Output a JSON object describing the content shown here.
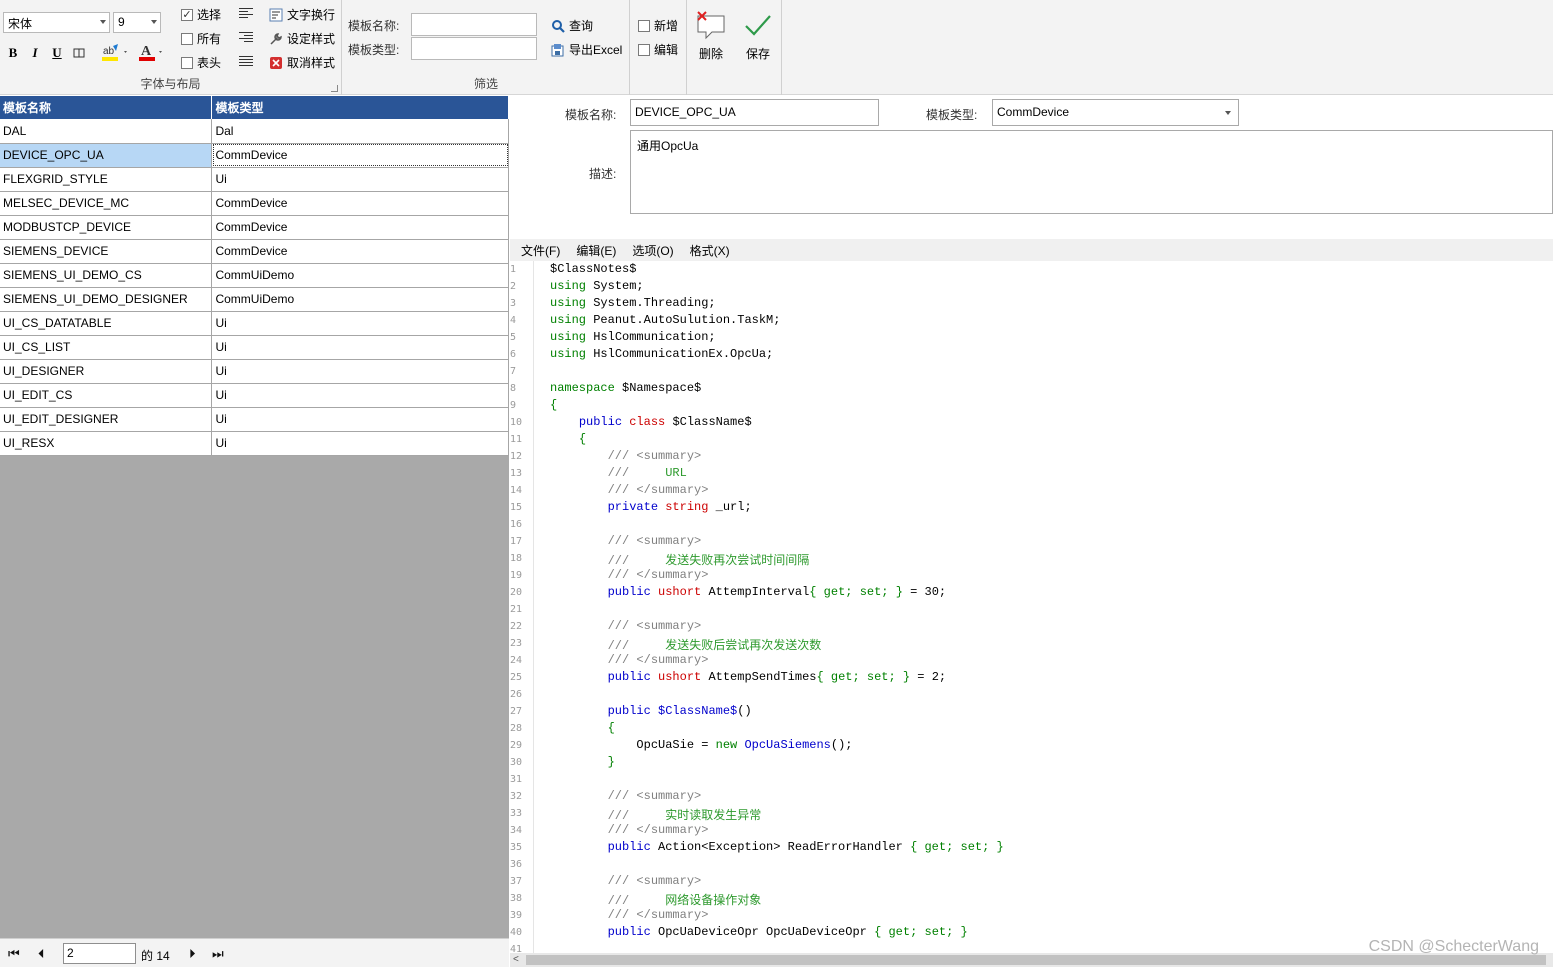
{
  "ribbon": {
    "font_group": {
      "font_name": "宋体",
      "font_size": "9",
      "bold": "B",
      "italic": "I",
      "underline": "U",
      "caption": "字体与布局"
    },
    "checks": [
      {
        "label": "选择",
        "checked": true
      },
      {
        "label": "所有",
        "checked": false
      },
      {
        "label": "表头",
        "checked": false
      }
    ],
    "style_buttons": [
      "文字换行",
      "设定样式",
      "取消样式"
    ],
    "filter_group": {
      "name_label": "模板名称:",
      "type_label": "模板类型:",
      "query": "查询",
      "export": "导出Excel",
      "caption": "筛选"
    },
    "edit_checks": [
      {
        "label": "新增",
        "checked": false
      },
      {
        "label": "编辑",
        "checked": false
      }
    ],
    "delete_label": "删除",
    "save_label": "保存"
  },
  "grid": {
    "headers": [
      "模板名称",
      "模板类型"
    ],
    "rows": [
      {
        "name": "DAL",
        "type": "Dal"
      },
      {
        "name": "DEVICE_OPC_UA",
        "type": "CommDevice"
      },
      {
        "name": "FLEXGRID_STYLE",
        "type": "Ui"
      },
      {
        "name": "MELSEC_DEVICE_MC",
        "type": "CommDevice"
      },
      {
        "name": "MODBUSTCP_DEVICE",
        "type": "CommDevice"
      },
      {
        "name": "SIEMENS_DEVICE",
        "type": "CommDevice"
      },
      {
        "name": "SIEMENS_UI_DEMO_CS",
        "type": "CommUiDemo"
      },
      {
        "name": "SIEMENS_UI_DEMO_DESIGNER",
        "type": "CommUiDemo"
      },
      {
        "name": "UI_CS_DATATABLE",
        "type": "Ui"
      },
      {
        "name": "UI_CS_LIST",
        "type": "Ui"
      },
      {
        "name": "UI_DESIGNER",
        "type": "Ui"
      },
      {
        "name": "UI_EDIT_CS",
        "type": "Ui"
      },
      {
        "name": "UI_EDIT_DESIGNER",
        "type": "Ui"
      },
      {
        "name": "UI_RESX",
        "type": "Ui"
      }
    ],
    "selected_row": 1
  },
  "pager": {
    "current": "2",
    "total": "的 14"
  },
  "detail": {
    "name_label": "模板名称:",
    "name_value": "DEVICE_OPC_UA",
    "type_label": "模板类型:",
    "type_value": "CommDevice",
    "desc_label": "描述:",
    "desc_value": "通用OpcUa"
  },
  "editor_menu": [
    "文件(F)",
    "编辑(E)",
    "选项(O)",
    "格式(X)"
  ],
  "code_lines": [
    [
      [
        "",
        "$ClassNotes$"
      ]
    ],
    [
      [
        "kg",
        "using"
      ],
      [
        "",
        " System;"
      ]
    ],
    [
      [
        "kg",
        "using"
      ],
      [
        "",
        " System.Threading;"
      ]
    ],
    [
      [
        "kg",
        "using"
      ],
      [
        "",
        " Peanut.AutoSulution.TaskM;"
      ]
    ],
    [
      [
        "kg",
        "using"
      ],
      [
        "",
        " HslCommunication;"
      ]
    ],
    [
      [
        "kg",
        "using"
      ],
      [
        "",
        " HslCommunicationEx.OpcUa;"
      ]
    ],
    [],
    [
      [
        "kg",
        "namespace"
      ],
      [
        "",
        " $Namespace$"
      ]
    ],
    [
      [
        "kg",
        "{"
      ]
    ],
    [
      [
        "",
        "    "
      ],
      [
        "kw",
        "public"
      ],
      [
        "",
        " "
      ],
      [
        "tp",
        "class"
      ],
      [
        "",
        " $ClassName$"
      ]
    ],
    [
      [
        "",
        "    "
      ],
      [
        "kg",
        "{"
      ]
    ],
    [
      [
        "",
        "        "
      ],
      [
        "cm",
        "/// <summary>"
      ]
    ],
    [
      [
        "",
        "        "
      ],
      [
        "cm",
        "///     "
      ],
      [
        "cz",
        "URL"
      ]
    ],
    [
      [
        "",
        "        "
      ],
      [
        "cm",
        "/// </summary>"
      ]
    ],
    [
      [
        "",
        "        "
      ],
      [
        "kw",
        "private"
      ],
      [
        "",
        " "
      ],
      [
        "tp",
        "string"
      ],
      [
        "",
        " _url;"
      ]
    ],
    [],
    [
      [
        "",
        "        "
      ],
      [
        "cm",
        "/// <summary>"
      ]
    ],
    [
      [
        "",
        "        "
      ],
      [
        "cm",
        "///     "
      ],
      [
        "cz",
        "发送失败再次尝试时间间隔"
      ]
    ],
    [
      [
        "",
        "        "
      ],
      [
        "cm",
        "/// </summary>"
      ]
    ],
    [
      [
        "",
        "        "
      ],
      [
        "kw",
        "public"
      ],
      [
        "",
        " "
      ],
      [
        "tp",
        "ushort"
      ],
      [
        "",
        " AttempInterval"
      ],
      [
        "kg",
        "{ get; set; }"
      ],
      [
        "",
        " = 30;"
      ]
    ],
    [],
    [
      [
        "",
        "        "
      ],
      [
        "cm",
        "/// <summary>"
      ]
    ],
    [
      [
        "",
        "        "
      ],
      [
        "cm",
        "///     "
      ],
      [
        "cz",
        "发送失败后尝试再次发送次数"
      ]
    ],
    [
      [
        "",
        "        "
      ],
      [
        "cm",
        "/// </summary>"
      ]
    ],
    [
      [
        "",
        "        "
      ],
      [
        "kw",
        "public"
      ],
      [
        "",
        " "
      ],
      [
        "tp",
        "ushort"
      ],
      [
        "",
        " AttempSendTimes"
      ],
      [
        "kg",
        "{ get; set; }"
      ],
      [
        "",
        " = 2;"
      ]
    ],
    [],
    [
      [
        "",
        "        "
      ],
      [
        "kw",
        "public"
      ],
      [
        "",
        " "
      ],
      [
        "kw",
        "$ClassName$"
      ],
      [
        "",
        "()"
      ]
    ],
    [
      [
        "",
        "        "
      ],
      [
        "kg",
        "{"
      ]
    ],
    [
      [
        "",
        "            OpcUaSie = "
      ],
      [
        "kg",
        "new"
      ],
      [
        "",
        " "
      ],
      [
        "kw",
        "OpcUaSiemens"
      ],
      [
        "",
        "();"
      ]
    ],
    [
      [
        "",
        "        "
      ],
      [
        "kg",
        "}"
      ]
    ],
    [],
    [
      [
        "",
        "        "
      ],
      [
        "cm",
        "/// <summary>"
      ]
    ],
    [
      [
        "",
        "        "
      ],
      [
        "cm",
        "///     "
      ],
      [
        "cz",
        "实时读取发生异常"
      ]
    ],
    [
      [
        "",
        "        "
      ],
      [
        "cm",
        "/// </summary>"
      ]
    ],
    [
      [
        "",
        "        "
      ],
      [
        "kw",
        "public"
      ],
      [
        "",
        " Action<Exception> ReadErrorHandler "
      ],
      [
        "kg",
        "{ get; set; }"
      ]
    ],
    [],
    [
      [
        "",
        "        "
      ],
      [
        "cm",
        "/// <summary>"
      ]
    ],
    [
      [
        "",
        "        "
      ],
      [
        "cm",
        "///     "
      ],
      [
        "cz",
        "网络设备操作对象"
      ]
    ],
    [
      [
        "",
        "        "
      ],
      [
        "cm",
        "/// </summary>"
      ]
    ],
    [
      [
        "",
        "        "
      ],
      [
        "kw",
        "public"
      ],
      [
        "",
        " OpcUaDeviceOpr OpcUaDeviceOpr "
      ],
      [
        "kg",
        "{ get; set; }"
      ]
    ],
    []
  ],
  "watermark": "CSDN @SchecterWang"
}
